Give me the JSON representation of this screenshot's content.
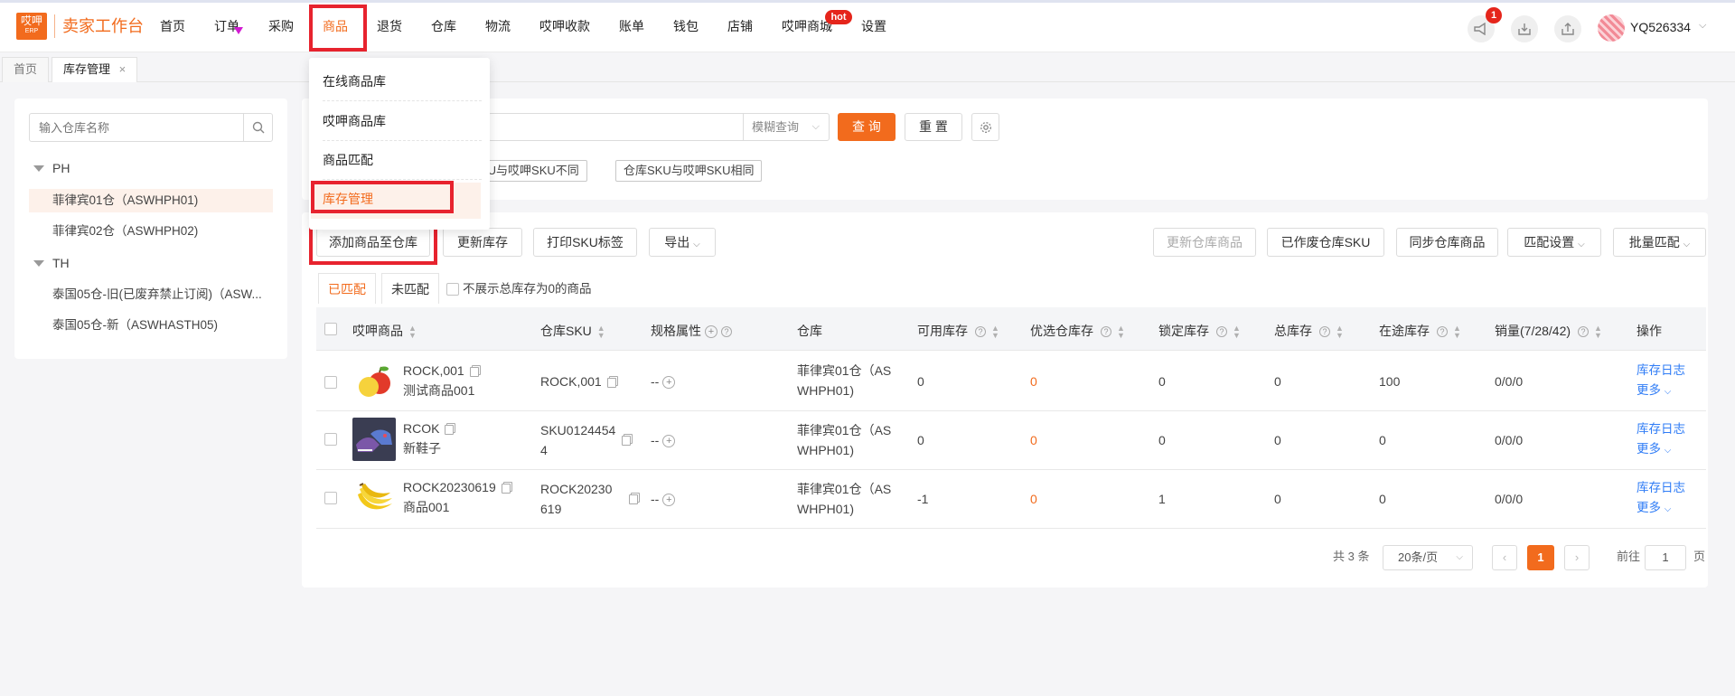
{
  "app": {
    "logo_text": "哎呷",
    "logo_sub": "ERP",
    "title": "卖家工作台",
    "username": "YQ526334",
    "notification_count": "1",
    "hot_badge": "hot"
  },
  "nav": {
    "items": [
      "首页",
      "订单",
      "采购",
      "商品",
      "退货",
      "仓库",
      "物流",
      "哎呷收款",
      "账单",
      "钱包",
      "店铺",
      "哎呷商城",
      "设置"
    ]
  },
  "tabs": {
    "home": "首页",
    "current": "库存管理",
    "close": "×"
  },
  "dropdown": {
    "items": [
      "在线商品库",
      "哎呷商品库",
      "商品匹配",
      "库存管理"
    ]
  },
  "left_panel": {
    "search_placeholder": "输入仓库名称",
    "groups": [
      {
        "name": "PH",
        "items": [
          "菲律宾01仓（ASWHPH01)",
          "菲律宾02仓（ASWHPH02)"
        ]
      },
      {
        "name": "TH",
        "items": [
          "泰国05仓-旧(已废弃禁止订阅)（ASW...",
          "泰国05仓-新（ASWHASTH05)"
        ]
      }
    ]
  },
  "filter": {
    "mode_select": "模糊查询",
    "query_button": "查 询",
    "reset_button": "重 置",
    "tag_1": "KU与哎呷SKU不同",
    "tag_2": "仓库SKU与哎呷SKU相同"
  },
  "toolbar": {
    "add_goods": "添加商品至仓库",
    "update_stock": "更新库存",
    "print_sku": "打印SKU标签",
    "export": "导出",
    "update_wh_goods": "更新仓库商品",
    "discarded_sku": "已作废仓库SKU",
    "sync_wh_goods": "同步仓库商品",
    "match_settings": "匹配设置",
    "batch_match": "批量匹配"
  },
  "subtabs": {
    "matched": "已匹配",
    "unmatched": "未匹配",
    "hide_zero": "不展示总库存为0的商品"
  },
  "table": {
    "headers": [
      "哎呷商品",
      "仓库SKU",
      "规格属性",
      "仓库",
      "可用库存",
      "优选仓库存",
      "锁定库存",
      "总库存",
      "在途库存",
      "销量(7/28/42)",
      "操作"
    ],
    "rows": [
      {
        "sku_code": "ROCK,001",
        "name": "测试商品001",
        "wh_sku": "ROCK,001",
        "wh_sku_2": "",
        "spec": "--",
        "warehouse": "菲律宾01仓（AS",
        "warehouse_2": "WHPH01)",
        "available": "0",
        "preferred": "0",
        "locked": "0",
        "total": "0",
        "in_transit": "100",
        "sales": "0/0/0",
        "log": "库存日志",
        "more": "更多"
      },
      {
        "sku_code": "RCOK",
        "name": "新鞋子",
        "wh_sku": "SKU0124454",
        "wh_sku_2": "4",
        "spec": "--",
        "warehouse": "菲律宾01仓（AS",
        "warehouse_2": "WHPH01)",
        "available": "0",
        "preferred": "0",
        "locked": "0",
        "total": "0",
        "in_transit": "0",
        "sales": "0/0/0",
        "log": "库存日志",
        "more": "更多"
      },
      {
        "sku_code": "ROCK20230619",
        "name": "商品001",
        "wh_sku": "ROCK20230",
        "wh_sku_2": "619",
        "spec": "--",
        "warehouse": "菲律宾01仓（AS",
        "warehouse_2": "WHPH01)",
        "available": "-1",
        "preferred": "0",
        "locked": "1",
        "total": "0",
        "in_transit": "0",
        "sales": "0/0/0",
        "log": "库存日志",
        "more": "更多"
      }
    ]
  },
  "pagination": {
    "total": "共 3 条",
    "page_size": "20条/页",
    "current_page": "1",
    "goto_label": "前往",
    "goto_value": "1",
    "page_unit": "页"
  },
  "colors": {
    "accent": "#f26b1d",
    "highlight_box": "#e7232e",
    "link": "#2f7cf6"
  }
}
